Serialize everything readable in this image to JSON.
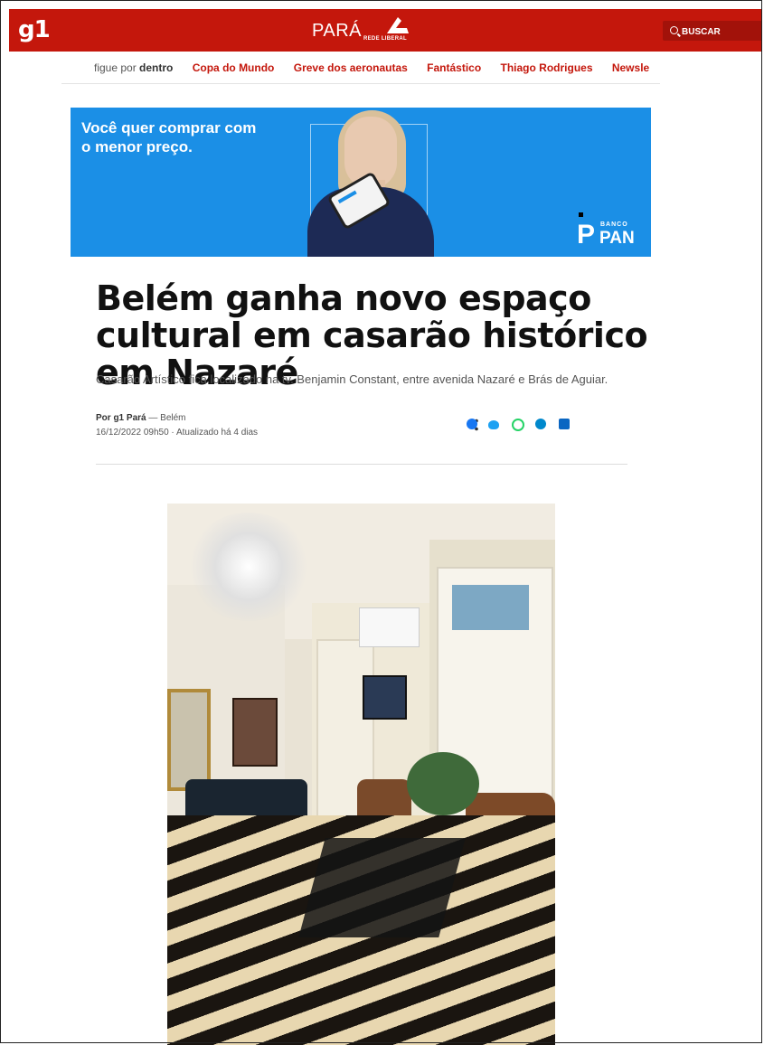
{
  "header": {
    "logo": "g1",
    "region": "PARÁ",
    "partner_logo_text": "REDE LIBERAL",
    "search_label": "BUSCAR"
  },
  "nav": {
    "figue_prefix": "figue por",
    "figue_bold": "dentro",
    "links": [
      "Copa do Mundo",
      "Greve dos aeronautas",
      "Fantástico",
      "Thiago Rodrigues",
      "Newsle"
    ]
  },
  "ad": {
    "headline": "Você quer comprar com o menor preço.",
    "brand_small": "BANCO",
    "brand_large": "PAN",
    "brand_color": "#1b8fe6"
  },
  "article": {
    "title": "Belém ganha novo espaço cultural em casarão histórico em Nazaré",
    "subtitle": "Casarão Artístico fica localizado na tv. Benjamin Constant, entre avenida Nazaré e Brás de Aguiar.",
    "author": "Por g1 Pará",
    "location": "— Belém",
    "timestamp": "16/12/2022 09h50 · Atualizado há 4 dias"
  },
  "share_icons": [
    "facebook-icon",
    "twitter-icon",
    "whatsapp-icon",
    "telegram-icon",
    "linkedin-icon",
    "share-icon"
  ],
  "colors": {
    "brand_red": "#c4170c",
    "link_red": "#c4170c"
  }
}
